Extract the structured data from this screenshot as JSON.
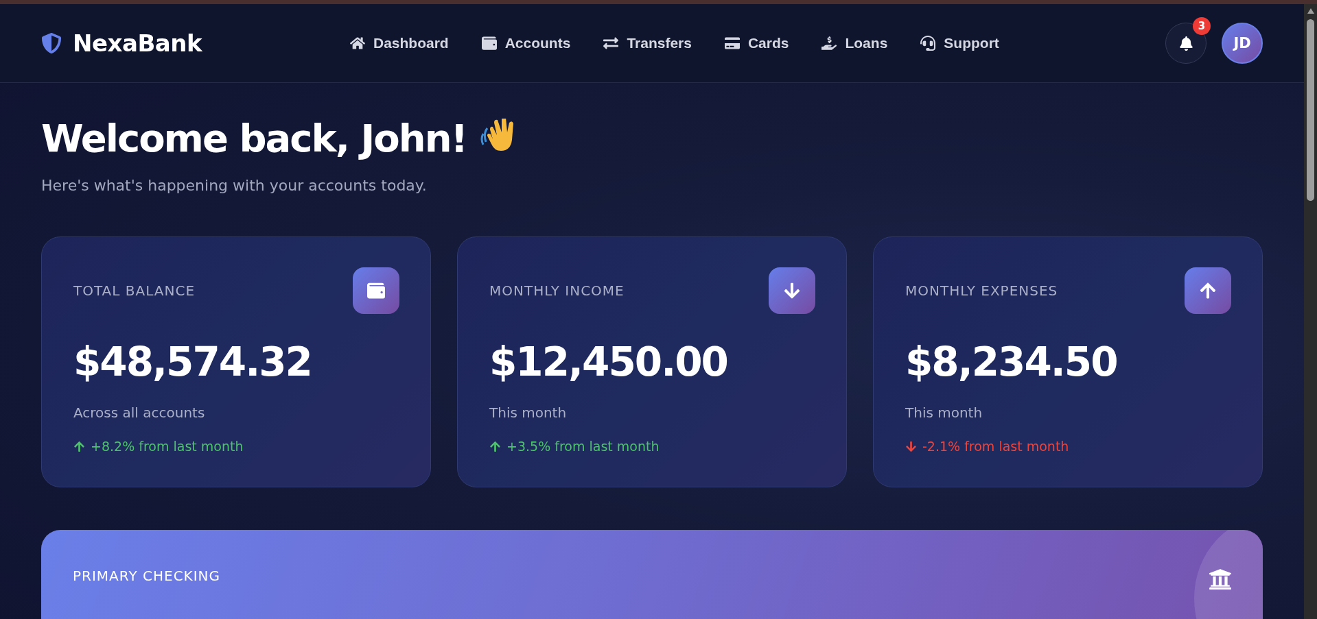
{
  "brand": {
    "name": "NexaBank"
  },
  "nav": [
    {
      "label": "Dashboard"
    },
    {
      "label": "Accounts"
    },
    {
      "label": "Transfers"
    },
    {
      "label": "Cards"
    },
    {
      "label": "Loans"
    },
    {
      "label": "Support"
    }
  ],
  "notifications": {
    "count": "3"
  },
  "user": {
    "initials": "JD"
  },
  "welcome": {
    "title": "Welcome back, John!",
    "subtitle": "Here's what's happening with your accounts today."
  },
  "stat_cards": [
    {
      "label": "TOTAL BALANCE",
      "amount": "$48,574.32",
      "note": "Across all accounts",
      "trend": {
        "kind": "up",
        "text": "+8.2% from last month"
      }
    },
    {
      "label": "MONTHLY INCOME",
      "amount": "$12,450.00",
      "note": "This month",
      "trend": {
        "kind": "up",
        "text": "+3.5% from last month"
      }
    },
    {
      "label": "MONTHLY EXPENSES",
      "amount": "$8,234.50",
      "note": "This month",
      "trend": {
        "kind": "down",
        "text": "-2.1% from last month"
      }
    }
  ],
  "account_card": {
    "label": "PRIMARY CHECKING"
  }
}
